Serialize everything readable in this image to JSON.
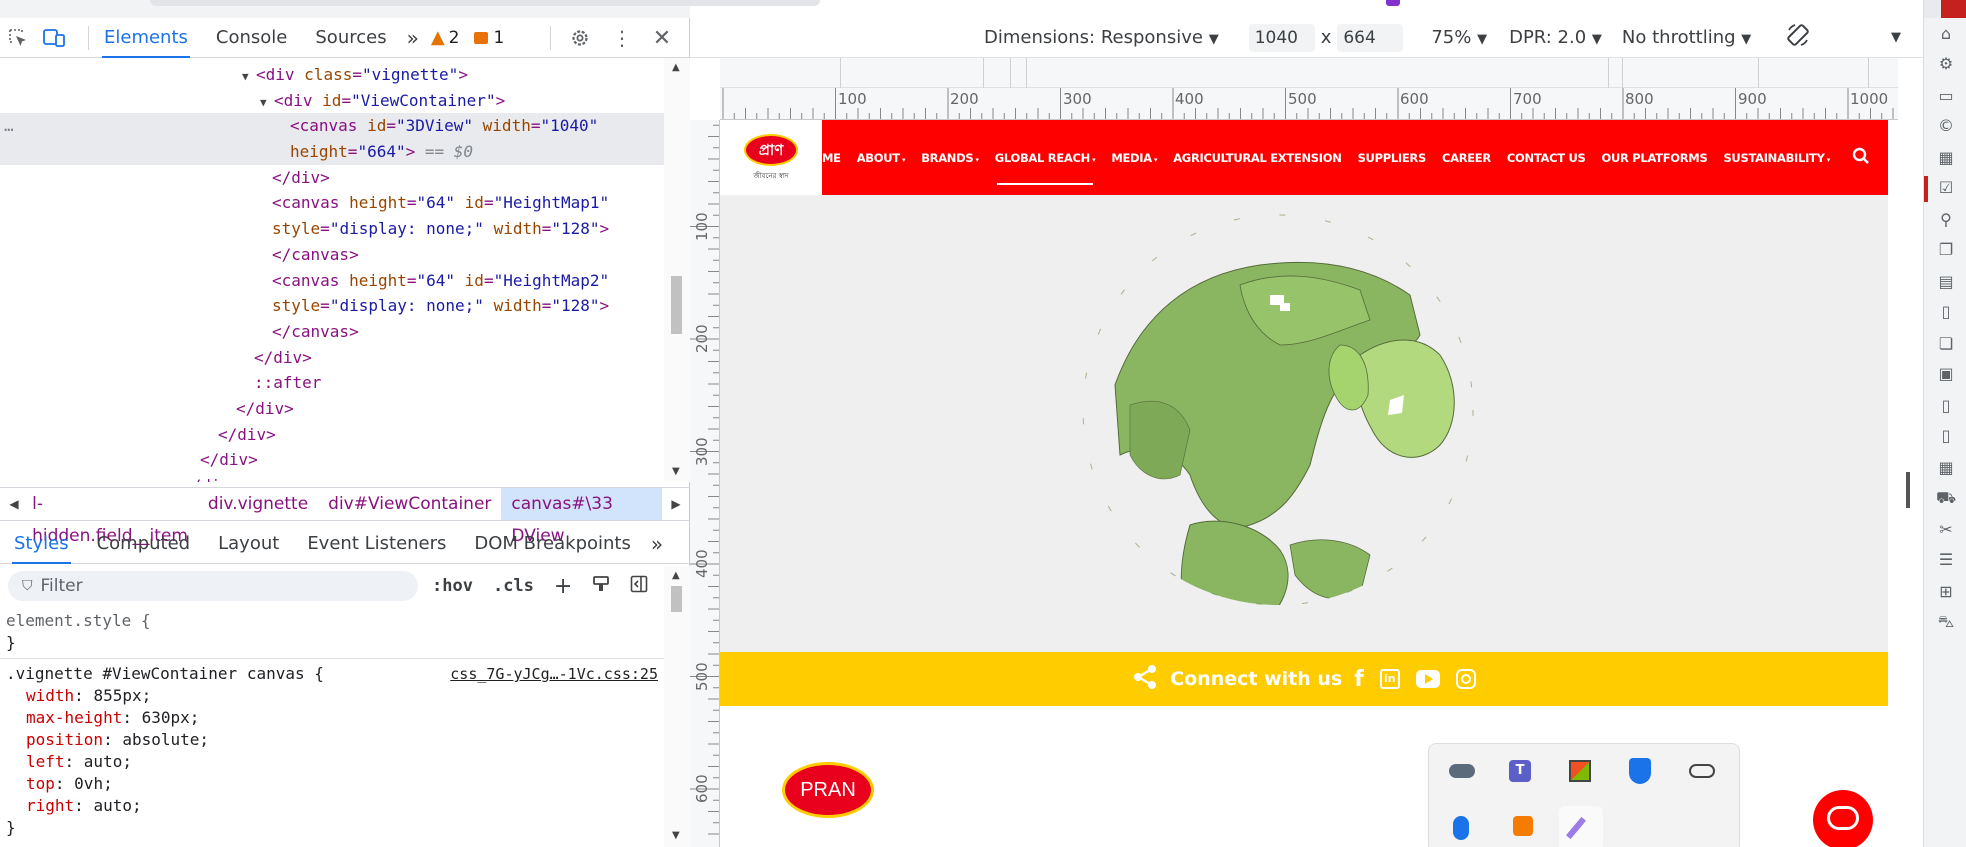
{
  "devtools": {
    "tabs": [
      "Elements",
      "Console",
      "Sources"
    ],
    "warnings": "2",
    "errors": "1",
    "tree": {
      "l1": {
        "tag_open": "<div ",
        "attr": "class",
        "val": "\"vignette\"",
        "close": ">"
      },
      "l2": {
        "tag_open": "<div ",
        "attr": "id",
        "val": "\"ViewContainer\"",
        "close": ">"
      },
      "l3a": {
        "tag_open": "<canvas ",
        "attr1": "id",
        "val1": "\"3DView\"",
        "attr2": " width",
        "val2": "\"1040\""
      },
      "l3b": {
        "attr": "height",
        "val": "\"664\"",
        "close": ">",
        "eq": " == $0"
      },
      "l4": "</div>",
      "l5a": {
        "tag_open": "<canvas ",
        "attr1": "height",
        "val1": "\"64\"",
        "attr2": " id",
        "val2": "\"HeightMap1\""
      },
      "l5b": {
        "attr1": "style",
        "val1": "\"display: none;\"",
        "attr2": " width",
        "val2": "\"128\"",
        "close": ">"
      },
      "l6": "</canvas>",
      "l7a": {
        "tag_open": "<canvas ",
        "attr1": "height",
        "val1": "\"64\"",
        "attr2": " id",
        "val2": "\"HeightMap2\""
      },
      "l7b": {
        "attr1": "style",
        "val1": "\"display: none;\"",
        "attr2": " width",
        "val2": "\"128\"",
        "close": ">"
      },
      "l8": "</canvas>",
      "l9": "</div>",
      "l10": "::after",
      "l11": "</div>",
      "l12": "</div>",
      "l13": "</div>",
      "l14": "</div>"
    },
    "breadcrumb": [
      "l-hidden.field__item",
      "div.vignette",
      "div#ViewContainer",
      "canvas#\\33 DView"
    ],
    "styles_tabs": [
      "Styles",
      "Computed",
      "Layout",
      "Event Listeners",
      "DOM Breakpoints"
    ],
    "filter_placeholder": "Filter",
    "hov": ":hov",
    "cls": ".cls",
    "element_style": "element.style {",
    "close_brace": "}",
    "rule_selector": ".vignette #ViewContainer canvas {",
    "rule_source": "css_7G-yJCg…-1Vc.css:25",
    "rule_props": [
      {
        "p": "width",
        "v": "855px;"
      },
      {
        "p": "max-height",
        "v": "630px;"
      },
      {
        "p": "position",
        "v": "absolute;"
      },
      {
        "p": "left",
        "v": "auto;"
      },
      {
        "p": "top",
        "v": "0vh;"
      },
      {
        "p": "right",
        "v": "auto;"
      }
    ]
  },
  "device_toolbar": {
    "dimensions": "Dimensions: Responsive",
    "width": "1040",
    "x": "x",
    "height": "664",
    "zoom": "75%",
    "dpr": "DPR: 2.0",
    "throttling": "No throttling"
  },
  "ruler": {
    "h": [
      "100",
      "200",
      "300",
      "400",
      "500",
      "600",
      "700",
      "800",
      "900",
      "1000"
    ],
    "v": [
      "100",
      "200",
      "300",
      "400",
      "500",
      "600"
    ]
  },
  "site": {
    "logo_text": "প্রাণ",
    "logo_sub": "জীবনের স্বাদ",
    "nav": [
      "ME",
      "ABOUT",
      "BRANDS",
      "GLOBAL REACH",
      "MEDIA",
      "AGRICULTURAL EXTENSION",
      "SUPPLIERS",
      "CAREER",
      "CONTACT US",
      "OUR PLATFORMS",
      "SUSTAINABILITY"
    ],
    "connect": "Connect with us",
    "footer_logo": "PRAN"
  },
  "colors": {
    "brand_red": "#ff0000",
    "connect_yellow": "#ffcc00",
    "globe_green": "#8ab661"
  }
}
